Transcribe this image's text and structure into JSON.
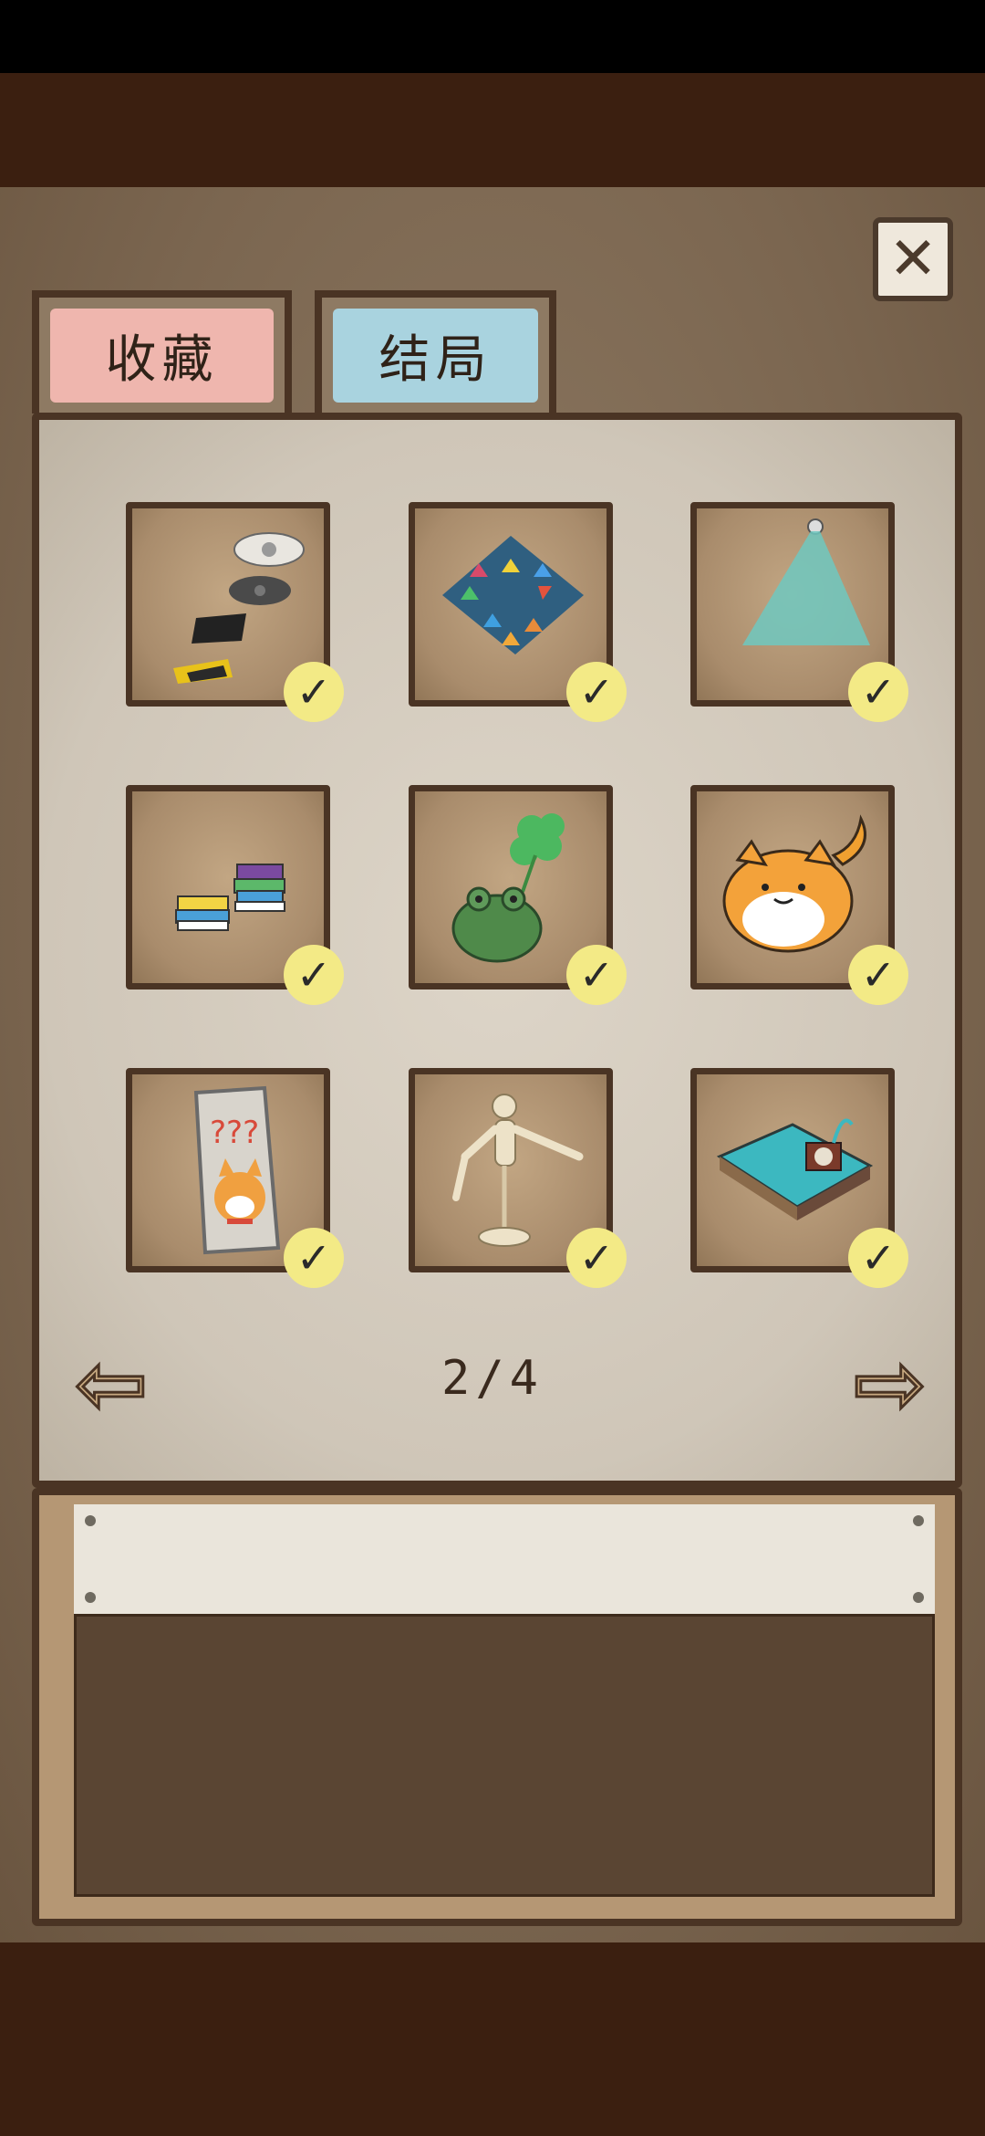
{
  "tabs": {
    "collection_label": "收藏",
    "ending_label": "结局"
  },
  "close_icon": "close-icon",
  "items": [
    {
      "name": "cds-and-cards",
      "collected": true
    },
    {
      "name": "arrow-puzzle-mat",
      "collected": true
    },
    {
      "name": "ceiling-light-beam",
      "collected": true
    },
    {
      "name": "stacked-books",
      "collected": true
    },
    {
      "name": "frog-with-clover",
      "collected": true
    },
    {
      "name": "orange-cat",
      "collected": true
    },
    {
      "name": "dog-poster",
      "collected": true
    },
    {
      "name": "wooden-mannequin",
      "collected": true
    },
    {
      "name": "teal-tray-with-clock",
      "collected": true
    }
  ],
  "pager": {
    "text": "2/4",
    "current": 2,
    "total": 4
  },
  "colors": {
    "collection_tab": "#efb6ae",
    "ending_tab": "#a9d3df",
    "check": "#f3ea86"
  }
}
